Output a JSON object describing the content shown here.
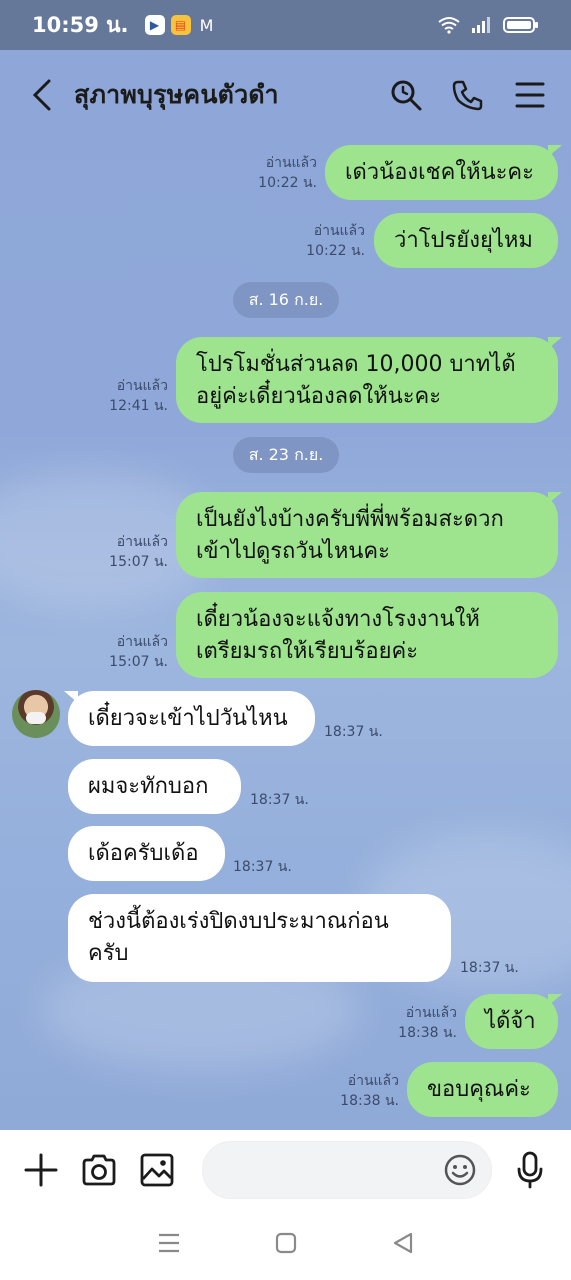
{
  "status": {
    "time": "10:59 น.",
    "battery": "battery-icon"
  },
  "header": {
    "title": "สุภาพบุรุษคนตัวดำ"
  },
  "messages": [
    {
      "text": "เด่วน้องเชคให้นะคะ",
      "read": "อ่านแล้ว",
      "time": "10:22 น."
    },
    {
      "text": "ว่าโปรยังยุไหม",
      "read": "อ่านแล้ว",
      "time": "10:22 น."
    },
    {
      "date": "ส. 16 ก.ย."
    },
    {
      "line1": "โปรโมชั่นส่วนลด 10,000 บาทได้",
      "line2": "อยู่ค่ะเดี๋ยวน้องลดให้นะคะ",
      "read": "อ่านแล้ว",
      "time": "12:41 น."
    },
    {
      "date": "ส. 23 ก.ย."
    },
    {
      "line1": "เป็นยังไงบ้างครับพี่พี่พร้อมสะดวก",
      "line2": "เข้าไปดูรถวันไหนคะ",
      "read": "อ่านแล้ว",
      "time": "15:07 น."
    },
    {
      "line1": "เดี๋ยวน้องจะแจ้งทางโรงงานให้",
      "line2": "เตรียมรถให้เรียบร้อยค่ะ",
      "read": "อ่านแล้ว",
      "time": "15:07 น."
    },
    {
      "text": "เดี๋ยวจะเข้าไปวันไหน",
      "time": "18:37 น."
    },
    {
      "text": "ผมจะทักบอก",
      "time": "18:37 น."
    },
    {
      "text": "เด้อครับเด้อ",
      "time": "18:37 น."
    },
    {
      "line1": "ช่วงนี้ต้องเร่งปิดงบประมาณก่อน",
      "line2": "ครับ",
      "time": "18:37 น."
    },
    {
      "text": "ได้จ้า",
      "read": "อ่านแล้ว",
      "time": "18:38 น."
    },
    {
      "text": "ขอบคุณค่ะ",
      "read": "อ่านแล้ว",
      "time": "18:38 น."
    }
  ],
  "input": {
    "placeholder": ""
  },
  "colors": {
    "outgoing": "#9ee38d",
    "incoming": "#ffffff",
    "background": "#8fa9d8"
  }
}
